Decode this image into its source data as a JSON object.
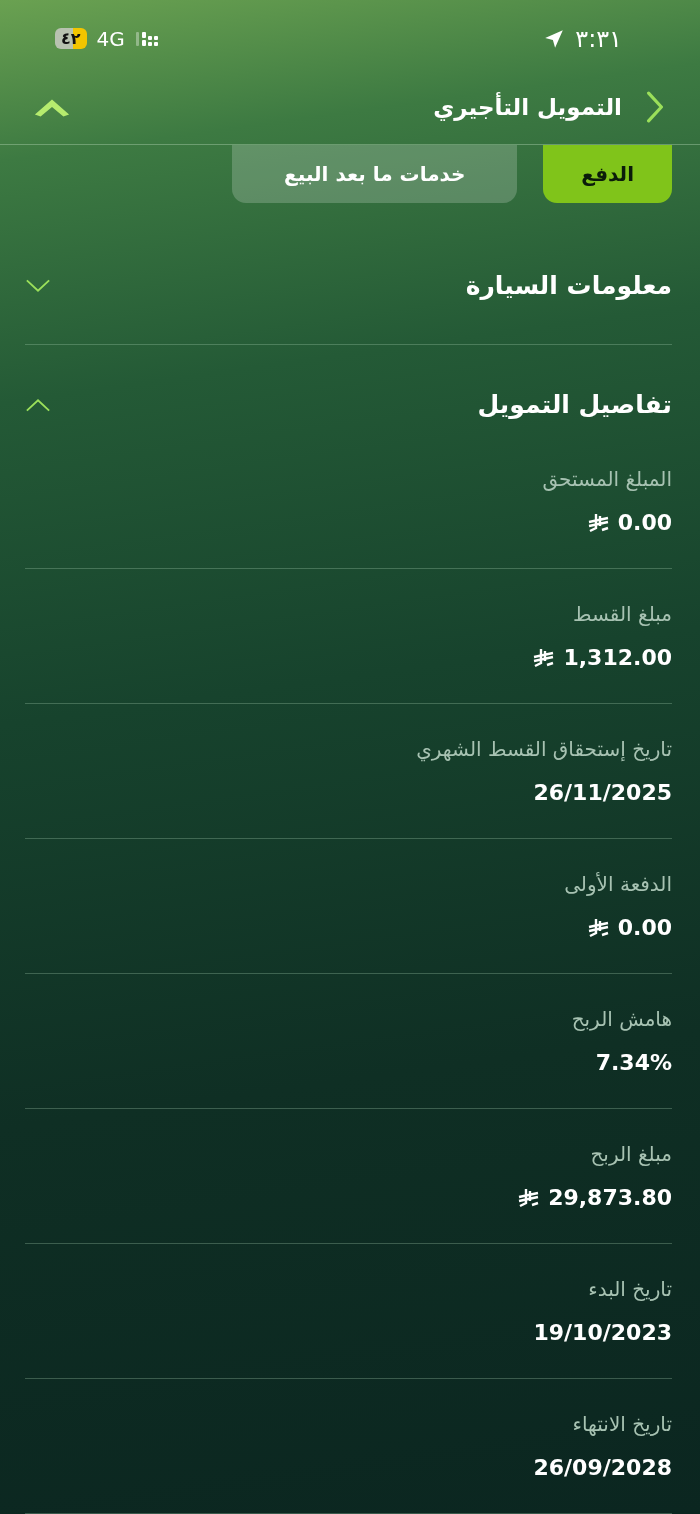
{
  "status_bar": {
    "time": "٣:٣١",
    "network": "4G",
    "battery": "٤٢"
  },
  "header": {
    "title": "التمويل التأجيري"
  },
  "tabs": [
    {
      "label": "الدفع",
      "selected": true
    },
    {
      "label": "خدمات ما بعد البيع",
      "selected": false
    }
  ],
  "sections": [
    {
      "title": "معلومات السيارة",
      "expanded": false
    },
    {
      "title": "تفاصيل التمويل",
      "expanded": true,
      "fields": [
        {
          "label": "المبلغ المستحق",
          "value": "0.00",
          "kind": "currency"
        },
        {
          "label": "مبلغ القسط",
          "value": "1,312.00",
          "kind": "currency"
        },
        {
          "label": "تاريخ إستحقاق القسط الشهري",
          "value": "26/11/2025",
          "kind": "text"
        },
        {
          "label": "الدفعة الأولى",
          "value": "0.00",
          "kind": "currency"
        },
        {
          "label": "هامش الربح",
          "value": "7.34%",
          "kind": "text"
        },
        {
          "label": "مبلغ الربح",
          "value": "29,873.80",
          "kind": "currency"
        },
        {
          "label": "تاريخ البدء",
          "value": "19/10/2023",
          "kind": "text"
        },
        {
          "label": "تاريخ الانتهاء",
          "value": "26/09/2028",
          "kind": "text"
        }
      ]
    }
  ]
}
